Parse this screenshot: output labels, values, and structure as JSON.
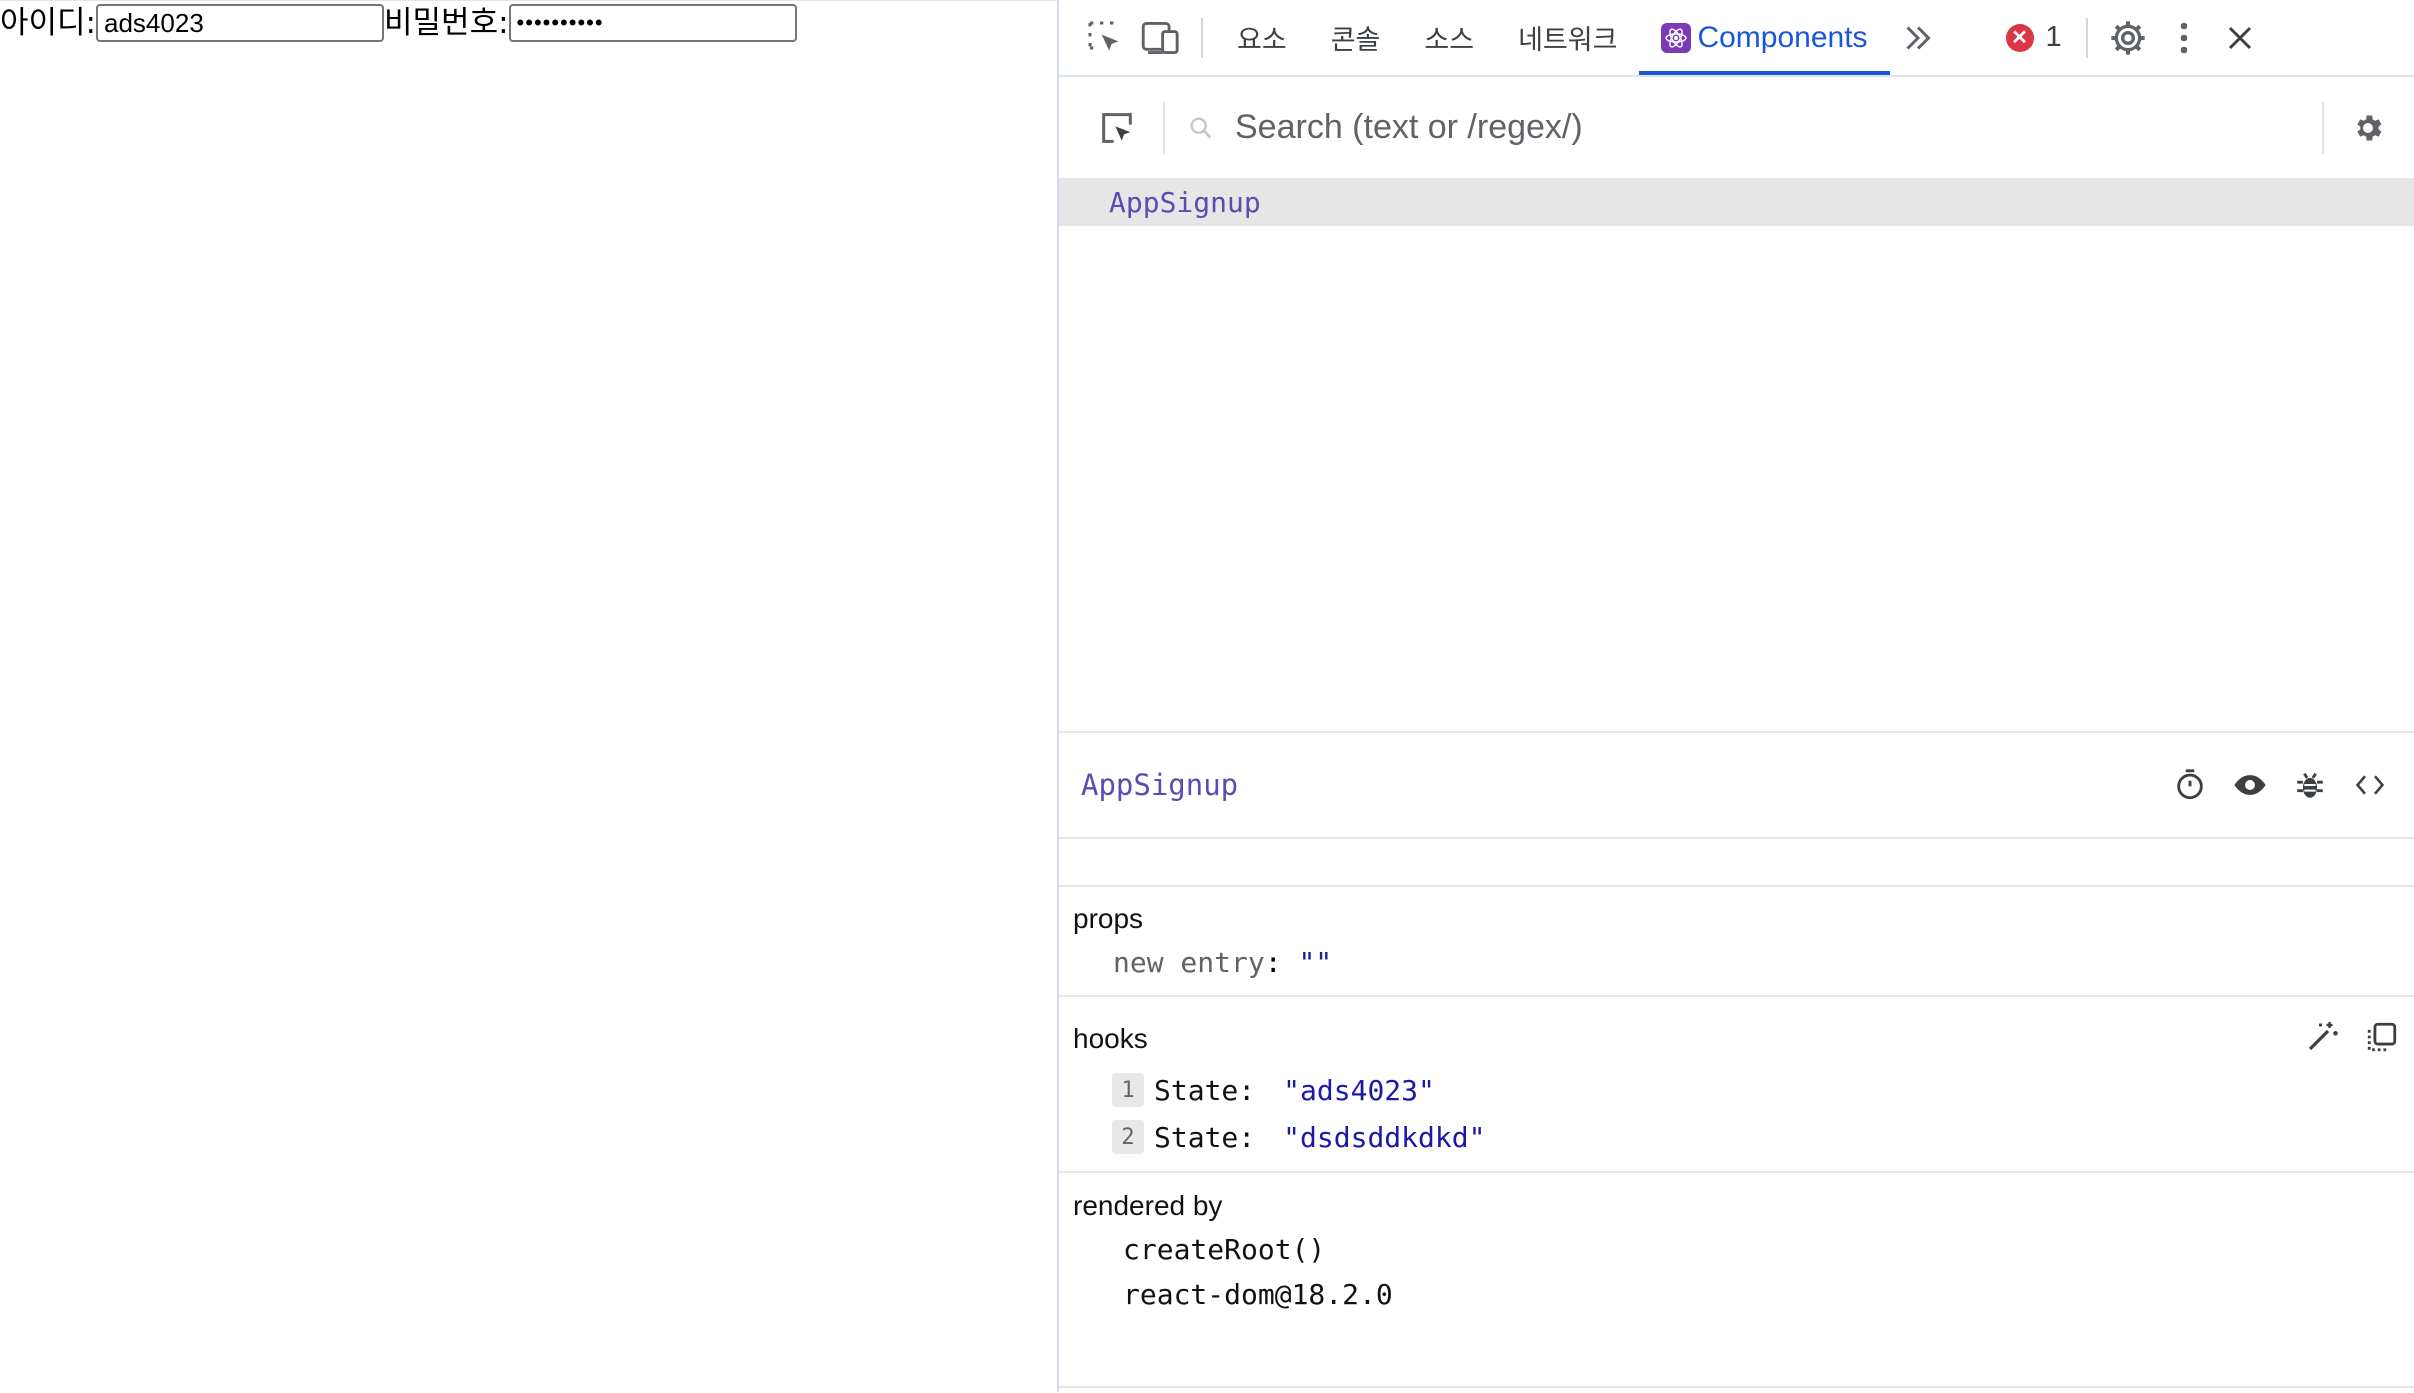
{
  "page": {
    "id_label": "아이디:",
    "id_value": "ads4023",
    "password_label": "비밀번호:",
    "password_value": "dsdsddkdkd"
  },
  "devtools": {
    "tabs": [
      "요소",
      "콘솔",
      "소스",
      "네트워크"
    ],
    "active_tab": "Components",
    "error_count": "1",
    "search": {
      "placeholder": "Search (text or /regex/)"
    },
    "tree": {
      "selected": "AppSignup"
    },
    "inspector": {
      "component": "AppSignup",
      "props_title": "props",
      "props_entry_key": "new entry",
      "props_entry_value": "\"\"",
      "hooks_title": "hooks",
      "hooks": [
        {
          "index": "1",
          "key": "State:",
          "value": "\"ads4023\""
        },
        {
          "index": "2",
          "key": "State:",
          "value": "\"dsdsddkdkd\""
        }
      ],
      "rendered_by_title": "rendered by",
      "rendered_by": [
        "createRoot()",
        "react-dom@18.2.0"
      ]
    }
  },
  "colors": {
    "accent": "#1a56db",
    "component_name": "#5b4cb3",
    "string": "#1a1aa6",
    "error": "#dc3545"
  }
}
